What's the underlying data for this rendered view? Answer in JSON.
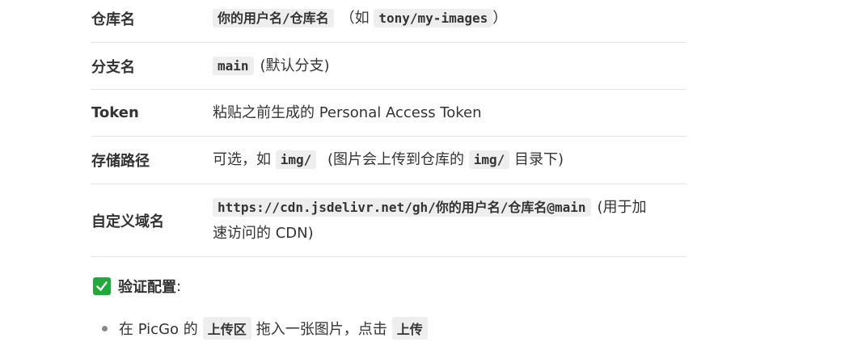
{
  "table": {
    "rows": [
      {
        "key": "仓库名",
        "code": "你的用户名/仓库名",
        "paren_open": "（如 ",
        "code2": "tony/my-images",
        "paren_close": "）"
      },
      {
        "key": "分支名",
        "code": "main",
        "rest": "(默认分支)"
      },
      {
        "key": "Token",
        "text": "粘贴之前生成的 Personal Access Token"
      },
      {
        "key": "存储路径",
        "prefix": "可选，如",
        "code": "img/",
        "mid": "(图片会上传到仓库的",
        "code2": "img/",
        "suffix": "目录下)"
      },
      {
        "key": "自定义域名",
        "code": "https://cdn.jsdelivr.net/gh/你的用户名/仓库名@main",
        "rest_line1": "(用于加",
        "rest_line2": "速访问的 CDN)"
      }
    ]
  },
  "verify": {
    "icon": "check-mark-button",
    "icon_color": "#22a93b",
    "title": "验证配置",
    "colon": ":"
  },
  "bullets": [
    {
      "prefix": "在 PicGo 的",
      "code": "上传区",
      "mid": "拖入一张图片，点击",
      "code2": "上传"
    }
  ]
}
